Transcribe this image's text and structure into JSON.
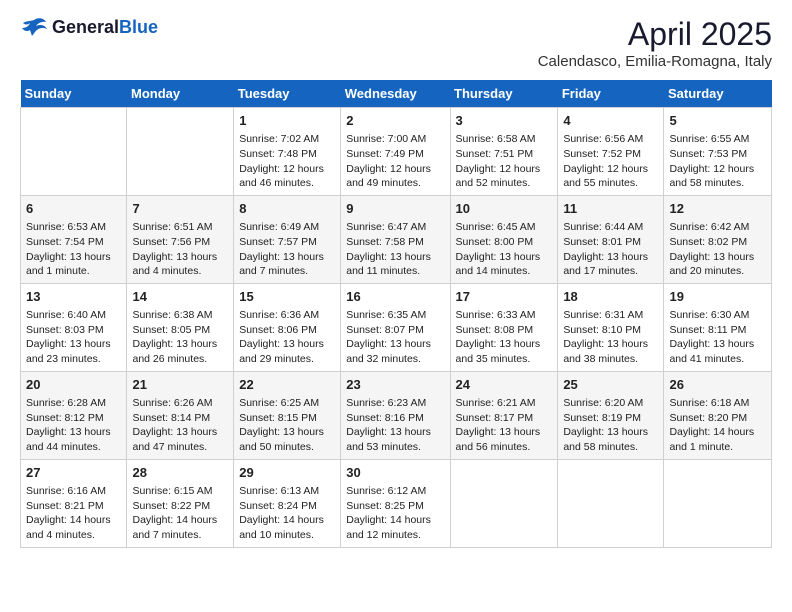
{
  "header": {
    "logo_general": "General",
    "logo_blue": "Blue",
    "title": "April 2025",
    "subtitle": "Calendasco, Emilia-Romagna, Italy"
  },
  "weekdays": [
    "Sunday",
    "Monday",
    "Tuesday",
    "Wednesday",
    "Thursday",
    "Friday",
    "Saturday"
  ],
  "weeks": [
    [
      {
        "day": "",
        "info": ""
      },
      {
        "day": "",
        "info": ""
      },
      {
        "day": "1",
        "info": "Sunrise: 7:02 AM\nSunset: 7:48 PM\nDaylight: 12 hours and 46 minutes."
      },
      {
        "day": "2",
        "info": "Sunrise: 7:00 AM\nSunset: 7:49 PM\nDaylight: 12 hours and 49 minutes."
      },
      {
        "day": "3",
        "info": "Sunrise: 6:58 AM\nSunset: 7:51 PM\nDaylight: 12 hours and 52 minutes."
      },
      {
        "day": "4",
        "info": "Sunrise: 6:56 AM\nSunset: 7:52 PM\nDaylight: 12 hours and 55 minutes."
      },
      {
        "day": "5",
        "info": "Sunrise: 6:55 AM\nSunset: 7:53 PM\nDaylight: 12 hours and 58 minutes."
      }
    ],
    [
      {
        "day": "6",
        "info": "Sunrise: 6:53 AM\nSunset: 7:54 PM\nDaylight: 13 hours and 1 minute."
      },
      {
        "day": "7",
        "info": "Sunrise: 6:51 AM\nSunset: 7:56 PM\nDaylight: 13 hours and 4 minutes."
      },
      {
        "day": "8",
        "info": "Sunrise: 6:49 AM\nSunset: 7:57 PM\nDaylight: 13 hours and 7 minutes."
      },
      {
        "day": "9",
        "info": "Sunrise: 6:47 AM\nSunset: 7:58 PM\nDaylight: 13 hours and 11 minutes."
      },
      {
        "day": "10",
        "info": "Sunrise: 6:45 AM\nSunset: 8:00 PM\nDaylight: 13 hours and 14 minutes."
      },
      {
        "day": "11",
        "info": "Sunrise: 6:44 AM\nSunset: 8:01 PM\nDaylight: 13 hours and 17 minutes."
      },
      {
        "day": "12",
        "info": "Sunrise: 6:42 AM\nSunset: 8:02 PM\nDaylight: 13 hours and 20 minutes."
      }
    ],
    [
      {
        "day": "13",
        "info": "Sunrise: 6:40 AM\nSunset: 8:03 PM\nDaylight: 13 hours and 23 minutes."
      },
      {
        "day": "14",
        "info": "Sunrise: 6:38 AM\nSunset: 8:05 PM\nDaylight: 13 hours and 26 minutes."
      },
      {
        "day": "15",
        "info": "Sunrise: 6:36 AM\nSunset: 8:06 PM\nDaylight: 13 hours and 29 minutes."
      },
      {
        "day": "16",
        "info": "Sunrise: 6:35 AM\nSunset: 8:07 PM\nDaylight: 13 hours and 32 minutes."
      },
      {
        "day": "17",
        "info": "Sunrise: 6:33 AM\nSunset: 8:08 PM\nDaylight: 13 hours and 35 minutes."
      },
      {
        "day": "18",
        "info": "Sunrise: 6:31 AM\nSunset: 8:10 PM\nDaylight: 13 hours and 38 minutes."
      },
      {
        "day": "19",
        "info": "Sunrise: 6:30 AM\nSunset: 8:11 PM\nDaylight: 13 hours and 41 minutes."
      }
    ],
    [
      {
        "day": "20",
        "info": "Sunrise: 6:28 AM\nSunset: 8:12 PM\nDaylight: 13 hours and 44 minutes."
      },
      {
        "day": "21",
        "info": "Sunrise: 6:26 AM\nSunset: 8:14 PM\nDaylight: 13 hours and 47 minutes."
      },
      {
        "day": "22",
        "info": "Sunrise: 6:25 AM\nSunset: 8:15 PM\nDaylight: 13 hours and 50 minutes."
      },
      {
        "day": "23",
        "info": "Sunrise: 6:23 AM\nSunset: 8:16 PM\nDaylight: 13 hours and 53 minutes."
      },
      {
        "day": "24",
        "info": "Sunrise: 6:21 AM\nSunset: 8:17 PM\nDaylight: 13 hours and 56 minutes."
      },
      {
        "day": "25",
        "info": "Sunrise: 6:20 AM\nSunset: 8:19 PM\nDaylight: 13 hours and 58 minutes."
      },
      {
        "day": "26",
        "info": "Sunrise: 6:18 AM\nSunset: 8:20 PM\nDaylight: 14 hours and 1 minute."
      }
    ],
    [
      {
        "day": "27",
        "info": "Sunrise: 6:16 AM\nSunset: 8:21 PM\nDaylight: 14 hours and 4 minutes."
      },
      {
        "day": "28",
        "info": "Sunrise: 6:15 AM\nSunset: 8:22 PM\nDaylight: 14 hours and 7 minutes."
      },
      {
        "day": "29",
        "info": "Sunrise: 6:13 AM\nSunset: 8:24 PM\nDaylight: 14 hours and 10 minutes."
      },
      {
        "day": "30",
        "info": "Sunrise: 6:12 AM\nSunset: 8:25 PM\nDaylight: 14 hours and 12 minutes."
      },
      {
        "day": "",
        "info": ""
      },
      {
        "day": "",
        "info": ""
      },
      {
        "day": "",
        "info": ""
      }
    ]
  ]
}
